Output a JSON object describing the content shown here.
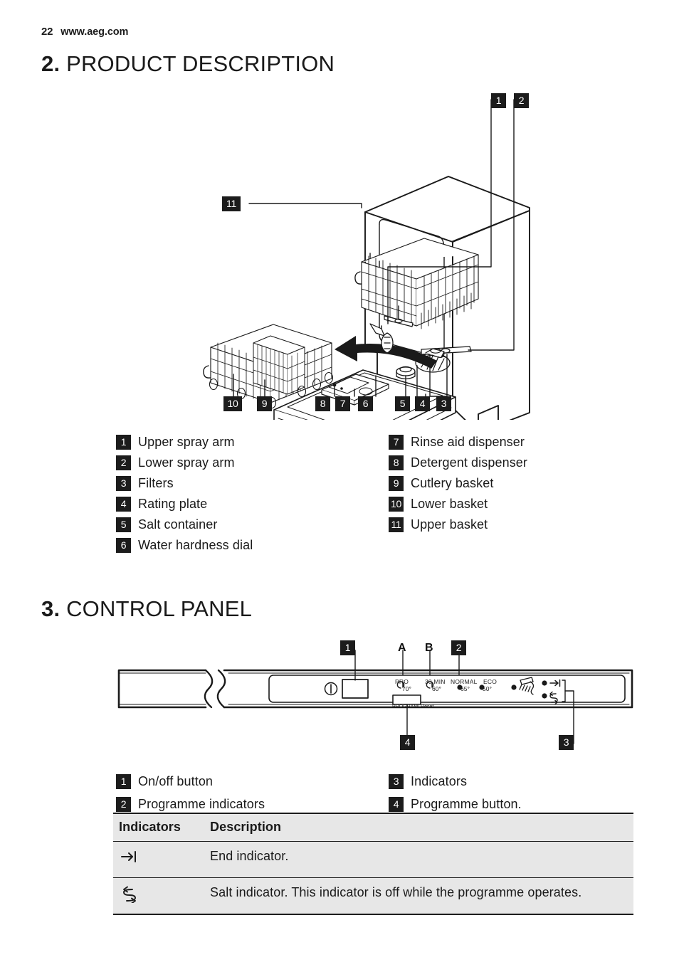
{
  "header": {
    "page_number": "22",
    "website": "www.aeg.com"
  },
  "sections": [
    {
      "number": "2.",
      "title": "PRODUCT DESCRIPTION"
    },
    {
      "number": "3.",
      "title": "CONTROL PANEL"
    }
  ],
  "product_diagram": {
    "callouts": [
      "1",
      "2",
      "3",
      "4",
      "5",
      "6",
      "7",
      "8",
      "9",
      "10",
      "11"
    ],
    "legend_left": [
      {
        "num": "1",
        "label": "Upper spray arm"
      },
      {
        "num": "2",
        "label": "Lower spray arm"
      },
      {
        "num": "3",
        "label": "Filters"
      },
      {
        "num": "4",
        "label": "Rating plate"
      },
      {
        "num": "5",
        "label": "Salt container"
      },
      {
        "num": "6",
        "label": "Water hardness dial"
      }
    ],
    "legend_right": [
      {
        "num": "7",
        "label": "Rinse aid dispenser"
      },
      {
        "num": "8",
        "label": "Detergent dispenser"
      },
      {
        "num": "9",
        "label": "Cutlery basket"
      },
      {
        "num": "10",
        "label": "Lower basket"
      },
      {
        "num": "11",
        "label": "Upper basket"
      }
    ]
  },
  "control_panel": {
    "callouts": [
      "1",
      "2",
      "3",
      "4"
    ],
    "letter_markers": [
      "A",
      "B"
    ],
    "programme_button_label": "PROGRAM/ Reset",
    "programmes": [
      {
        "name": "PRO",
        "temperature": "70°"
      },
      {
        "name": "30 MIN",
        "temperature": "60°"
      },
      {
        "name": "NORMAL",
        "temperature": "65°"
      },
      {
        "name": "ECO",
        "temperature": "50°"
      }
    ],
    "icons": {
      "power": "power-icon",
      "rinse": "rinse-spray-icon",
      "end": "end-arrow-icon",
      "salt": "salt-icon"
    },
    "legend_left": [
      {
        "num": "1",
        "label": "On/off button"
      },
      {
        "num": "2",
        "label": "Programme indicators"
      }
    ],
    "legend_right": [
      {
        "num": "3",
        "label": "Indicators"
      },
      {
        "num": "4",
        "label": "Programme button."
      }
    ]
  },
  "indicators_table": {
    "headers": {
      "col1": "Indicators",
      "col2": "Description"
    },
    "rows": [
      {
        "icon": "end-arrow-icon",
        "description": "End indicator."
      },
      {
        "icon": "salt-icon",
        "description": "Salt indicator. This indicator is off while the programme operates."
      }
    ]
  },
  "colors": {
    "chip_background": "#1c1c1c",
    "chip_text": "#ffffff",
    "table_background": "#e7e7e7",
    "rule": "#1c1c1c",
    "text": "#1a1a1a"
  }
}
